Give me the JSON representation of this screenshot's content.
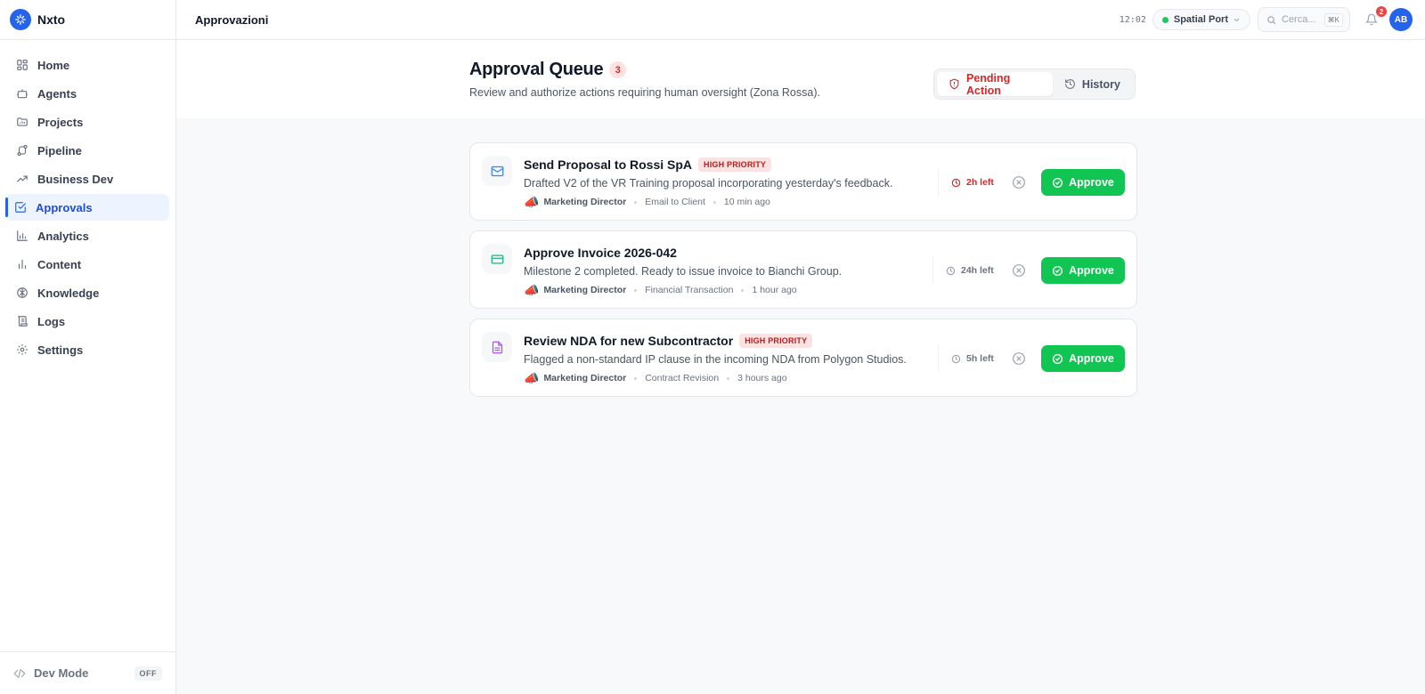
{
  "app": {
    "name": "Nxto"
  },
  "sidebar": {
    "items": [
      {
        "label": "Home",
        "icon": "home-icon",
        "active": false
      },
      {
        "label": "Agents",
        "icon": "bot-icon",
        "active": false
      },
      {
        "label": "Projects",
        "icon": "folder-icon",
        "active": false
      },
      {
        "label": "Pipeline",
        "icon": "route-icon",
        "active": false
      },
      {
        "label": "Business Dev",
        "icon": "trending-up-icon",
        "active": false
      },
      {
        "label": "Approvals",
        "icon": "check-square-icon",
        "active": true
      },
      {
        "label": "Analytics",
        "icon": "bar-chart-icon",
        "active": false
      },
      {
        "label": "Content",
        "icon": "bar-chart-2-icon",
        "active": false
      },
      {
        "label": "Knowledge",
        "icon": "brain-icon",
        "active": false
      },
      {
        "label": "Logs",
        "icon": "scroll-icon",
        "active": false
      },
      {
        "label": "Settings",
        "icon": "gear-icon",
        "active": false
      }
    ],
    "dev_mode": {
      "label": "Dev Mode",
      "state": "OFF"
    }
  },
  "topbar": {
    "title": "Approvazioni",
    "clock": "12:02",
    "workspace": "Spatial Port",
    "search_placeholder": "Cerca...",
    "search_shortcut": "⌘K",
    "notifications": "2",
    "avatar": "AB"
  },
  "page": {
    "title": "Approval Queue",
    "count": "3",
    "subtitle": "Review and authorize actions requiring human oversight (Zona Rossa).",
    "tabs": [
      {
        "label": "Pending Action",
        "active": true
      },
      {
        "label": "History",
        "active": false
      }
    ]
  },
  "approvals": [
    {
      "title": "Send Proposal to Rossi SpA",
      "priority": "HIGH PRIORITY",
      "description": "Drafted V2 of the VR Training proposal incorporating yesterday's feedback.",
      "agent_emoji": "📣",
      "agent": "Marketing Director",
      "type": "Email to Client",
      "time": "10 min ago",
      "time_left": "2h left",
      "urgent": true,
      "icon": "mail-icon",
      "icon_color": "#3b82f6",
      "approve_label": "Approve"
    },
    {
      "title": "Approve Invoice 2026-042",
      "priority": "",
      "description": "Milestone 2 completed. Ready to issue invoice to Bianchi Group.",
      "agent_emoji": "📣",
      "agent": "Marketing Director",
      "type": "Financial Transaction",
      "time": "1 hour ago",
      "time_left": "24h left",
      "urgent": false,
      "icon": "credit-card-icon",
      "icon_color": "#10b981",
      "approve_label": "Approve"
    },
    {
      "title": "Review NDA for new Subcontractor",
      "priority": "HIGH PRIORITY",
      "description": "Flagged a non-standard IP clause in the incoming NDA from Polygon Studios.",
      "agent_emoji": "📣",
      "agent": "Marketing Director",
      "type": "Contract Revision",
      "time": "3 hours ago",
      "time_left": "5h left",
      "urgent": false,
      "icon": "file-text-icon",
      "icon_color": "#a855f7",
      "approve_label": "Approve"
    }
  ],
  "colors": {
    "accent": "#2563eb",
    "approve": "#10c552",
    "danger": "#dc2626",
    "danger_bg": "#fee2e2"
  }
}
